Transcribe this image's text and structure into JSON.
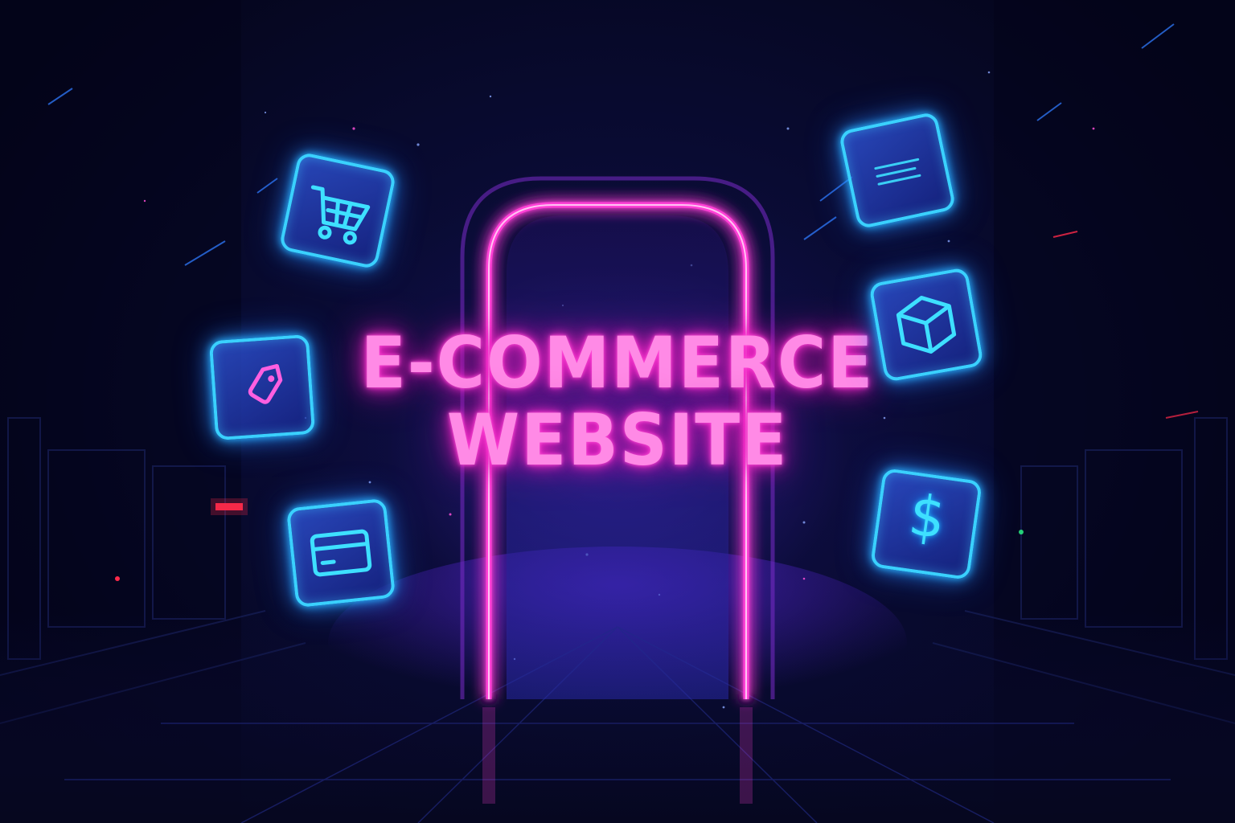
{
  "title": {
    "line1": "E-COMMERCE",
    "line2": "WEBSITE"
  },
  "icons": {
    "left": [
      "shopping-cart-icon",
      "price-tag-icon",
      "credit-card-icon"
    ],
    "right": [
      "list-icon",
      "package-box-icon",
      "dollar-icon"
    ]
  },
  "dollar_symbol": "$",
  "colors": {
    "background": "#05061e",
    "neon_pink": "#ff3fd6",
    "title_pink": "#ff8ae6",
    "neon_blue": "#3ad1ff",
    "tile_fill": "#2a48c8",
    "accent_red": "#ff2a4a"
  }
}
